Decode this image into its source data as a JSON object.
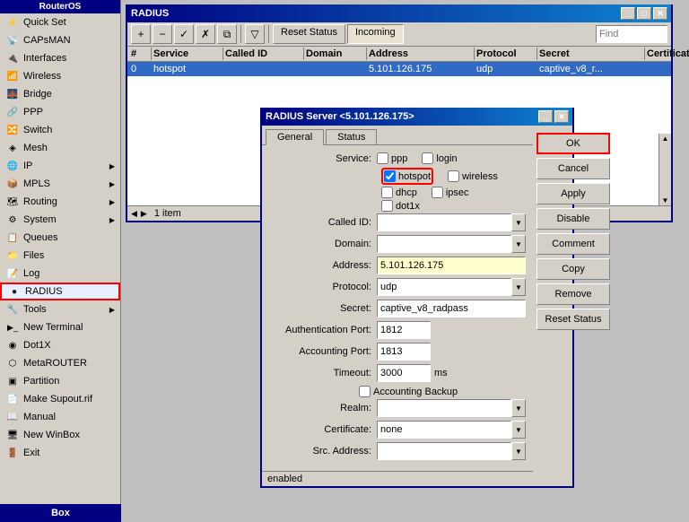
{
  "sidebar": {
    "header": "RouterOS",
    "items": [
      {
        "id": "quick-set",
        "label": "Quick Set",
        "icon": "⚡",
        "hasArrow": false
      },
      {
        "id": "capsman",
        "label": "CAPsMAN",
        "icon": "📡",
        "hasArrow": false
      },
      {
        "id": "interfaces",
        "label": "Interfaces",
        "icon": "🔌",
        "hasArrow": false
      },
      {
        "id": "wireless",
        "label": "Wireless",
        "icon": "📶",
        "hasArrow": false
      },
      {
        "id": "bridge",
        "label": "Bridge",
        "icon": "🌉",
        "hasArrow": false
      },
      {
        "id": "ppp",
        "label": "PPP",
        "icon": "🔗",
        "hasArrow": false
      },
      {
        "id": "switch",
        "label": "Switch",
        "icon": "🔀",
        "hasArrow": false
      },
      {
        "id": "mesh",
        "label": "Mesh",
        "icon": "◈",
        "hasArrow": false
      },
      {
        "id": "ip",
        "label": "IP",
        "icon": "🌐",
        "hasArrow": true
      },
      {
        "id": "mpls",
        "label": "MPLS",
        "icon": "📦",
        "hasArrow": true
      },
      {
        "id": "routing",
        "label": "Routing",
        "icon": "🗺",
        "hasArrow": true
      },
      {
        "id": "system",
        "label": "System",
        "icon": "⚙",
        "hasArrow": true
      },
      {
        "id": "queues",
        "label": "Queues",
        "icon": "📋",
        "hasArrow": false
      },
      {
        "id": "files",
        "label": "Files",
        "icon": "📁",
        "hasArrow": false
      },
      {
        "id": "log",
        "label": "Log",
        "icon": "📝",
        "hasArrow": false
      },
      {
        "id": "radius",
        "label": "RADIUS",
        "icon": "●",
        "hasArrow": false,
        "active": true
      },
      {
        "id": "tools",
        "label": "Tools",
        "icon": "🔧",
        "hasArrow": true
      },
      {
        "id": "new-terminal",
        "label": "New Terminal",
        "icon": ">_",
        "hasArrow": false
      },
      {
        "id": "dot1x",
        "label": "Dot1X",
        "icon": "◉",
        "hasArrow": false
      },
      {
        "id": "metarouter",
        "label": "MetaROUTER",
        "icon": "⬡",
        "hasArrow": false
      },
      {
        "id": "partition",
        "label": "Partition",
        "icon": "▣",
        "hasArrow": false
      },
      {
        "id": "make-supout",
        "label": "Make Supout.rif",
        "icon": "📄",
        "hasArrow": false
      },
      {
        "id": "manual",
        "label": "Manual",
        "icon": "📖",
        "hasArrow": false
      },
      {
        "id": "new-winbox",
        "label": "New WinBox",
        "icon": "🖥",
        "hasArrow": false
      },
      {
        "id": "exit",
        "label": "Exit",
        "icon": "🚪",
        "hasArrow": false
      }
    ]
  },
  "radius_window": {
    "title": "RADIUS",
    "toolbar": {
      "add_icon": "+",
      "remove_icon": "−",
      "enable_icon": "✓",
      "disable_icon": "✗",
      "copy_icon": "⧉",
      "filter_icon": "▽",
      "reset_status_label": "Reset Status",
      "incoming_label": "Incoming",
      "find_placeholder": "Find"
    },
    "table": {
      "columns": [
        "#",
        "Service",
        "Called ID",
        "Domain",
        "Address",
        "Protocol",
        "Secret",
        "Certificate"
      ],
      "rows": [
        {
          "num": "0",
          "service": "hotspot",
          "called_id": "",
          "domain": "",
          "address": "5.101.126.175",
          "protocol": "udp",
          "secret": "captive_v8_r...",
          "certificate": ""
        }
      ]
    },
    "status_text": "1 item"
  },
  "server_dialog": {
    "title": "RADIUS Server <5.101.126.175>",
    "tabs": [
      "General",
      "Status"
    ],
    "active_tab": "General",
    "service": {
      "ppp_label": "ppp",
      "login_label": "login",
      "hotspot_label": "hotspot",
      "hotspot_checked": true,
      "wireless_label": "wireless",
      "wireless_checked": false,
      "dhcp_label": "dhcp",
      "dhcp_checked": false,
      "ipsec_label": "ipsec",
      "ipsec_checked": false,
      "dot1x_label": "dot1x",
      "dot1x_checked": false
    },
    "fields": {
      "called_id_label": "Called ID:",
      "called_id_value": "",
      "domain_label": "Domain:",
      "domain_value": "",
      "address_label": "Address:",
      "address_value": "5.101.126.175",
      "protocol_label": "Protocol:",
      "protocol_value": "udp",
      "secret_label": "Secret:",
      "secret_value": "captive_v8_radpass",
      "auth_port_label": "Authentication Port:",
      "auth_port_value": "1812",
      "acct_port_label": "Accounting Port:",
      "acct_port_value": "1813",
      "timeout_label": "Timeout:",
      "timeout_value": "3000",
      "timeout_unit": "ms",
      "acct_backup_label": "Accounting Backup",
      "realm_label": "Realm:",
      "realm_value": "",
      "cert_label": "Certificate:",
      "cert_value": "none",
      "src_addr_label": "Src. Address:",
      "src_addr_value": ""
    },
    "buttons": {
      "ok": "OK",
      "cancel": "Cancel",
      "apply": "Apply",
      "disable": "Disable",
      "comment": "Comment",
      "copy": "Copy",
      "remove": "Remove",
      "reset_status": "Reset Status"
    },
    "status_bar": "enabled"
  },
  "box_label": "Box"
}
